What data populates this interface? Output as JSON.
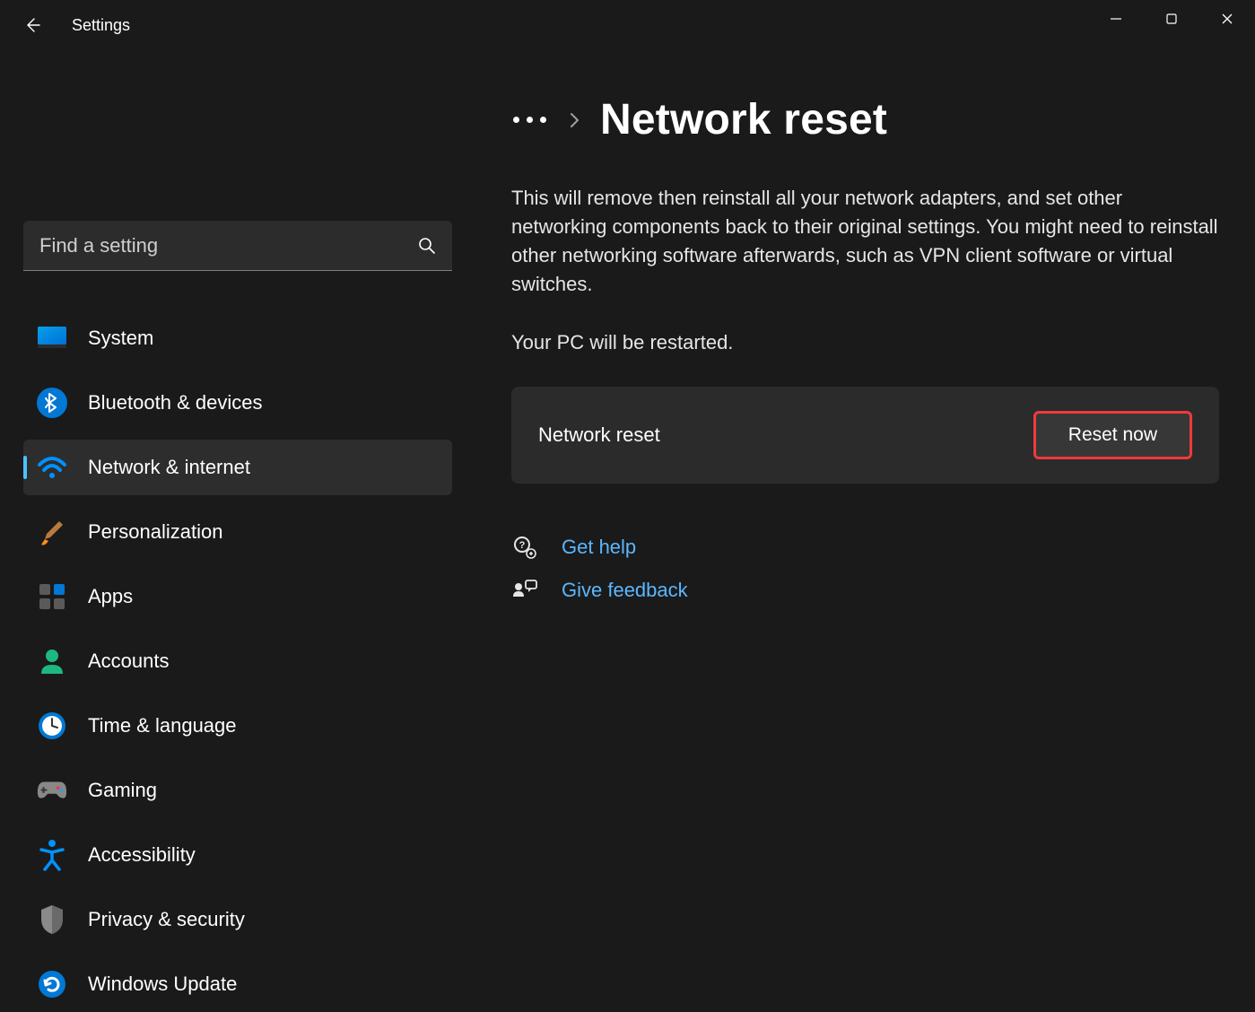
{
  "app_title": "Settings",
  "search": {
    "placeholder": "Find a setting"
  },
  "sidebar": {
    "items": [
      {
        "label": "System"
      },
      {
        "label": "Bluetooth & devices"
      },
      {
        "label": "Network & internet"
      },
      {
        "label": "Personalization"
      },
      {
        "label": "Apps"
      },
      {
        "label": "Accounts"
      },
      {
        "label": "Time & language"
      },
      {
        "label": "Gaming"
      },
      {
        "label": "Accessibility"
      },
      {
        "label": "Privacy & security"
      },
      {
        "label": "Windows Update"
      }
    ],
    "active_index": 2
  },
  "page": {
    "title": "Network reset",
    "description": "This will remove then reinstall all your network adapters, and set other networking components back to their original settings. You might need to reinstall other networking software afterwards, such as VPN client software or virtual switches.",
    "restart_note": "Your PC will be restarted.",
    "card": {
      "label": "Network reset",
      "button": "Reset now"
    },
    "links": {
      "help": "Get help",
      "feedback": "Give feedback"
    }
  }
}
